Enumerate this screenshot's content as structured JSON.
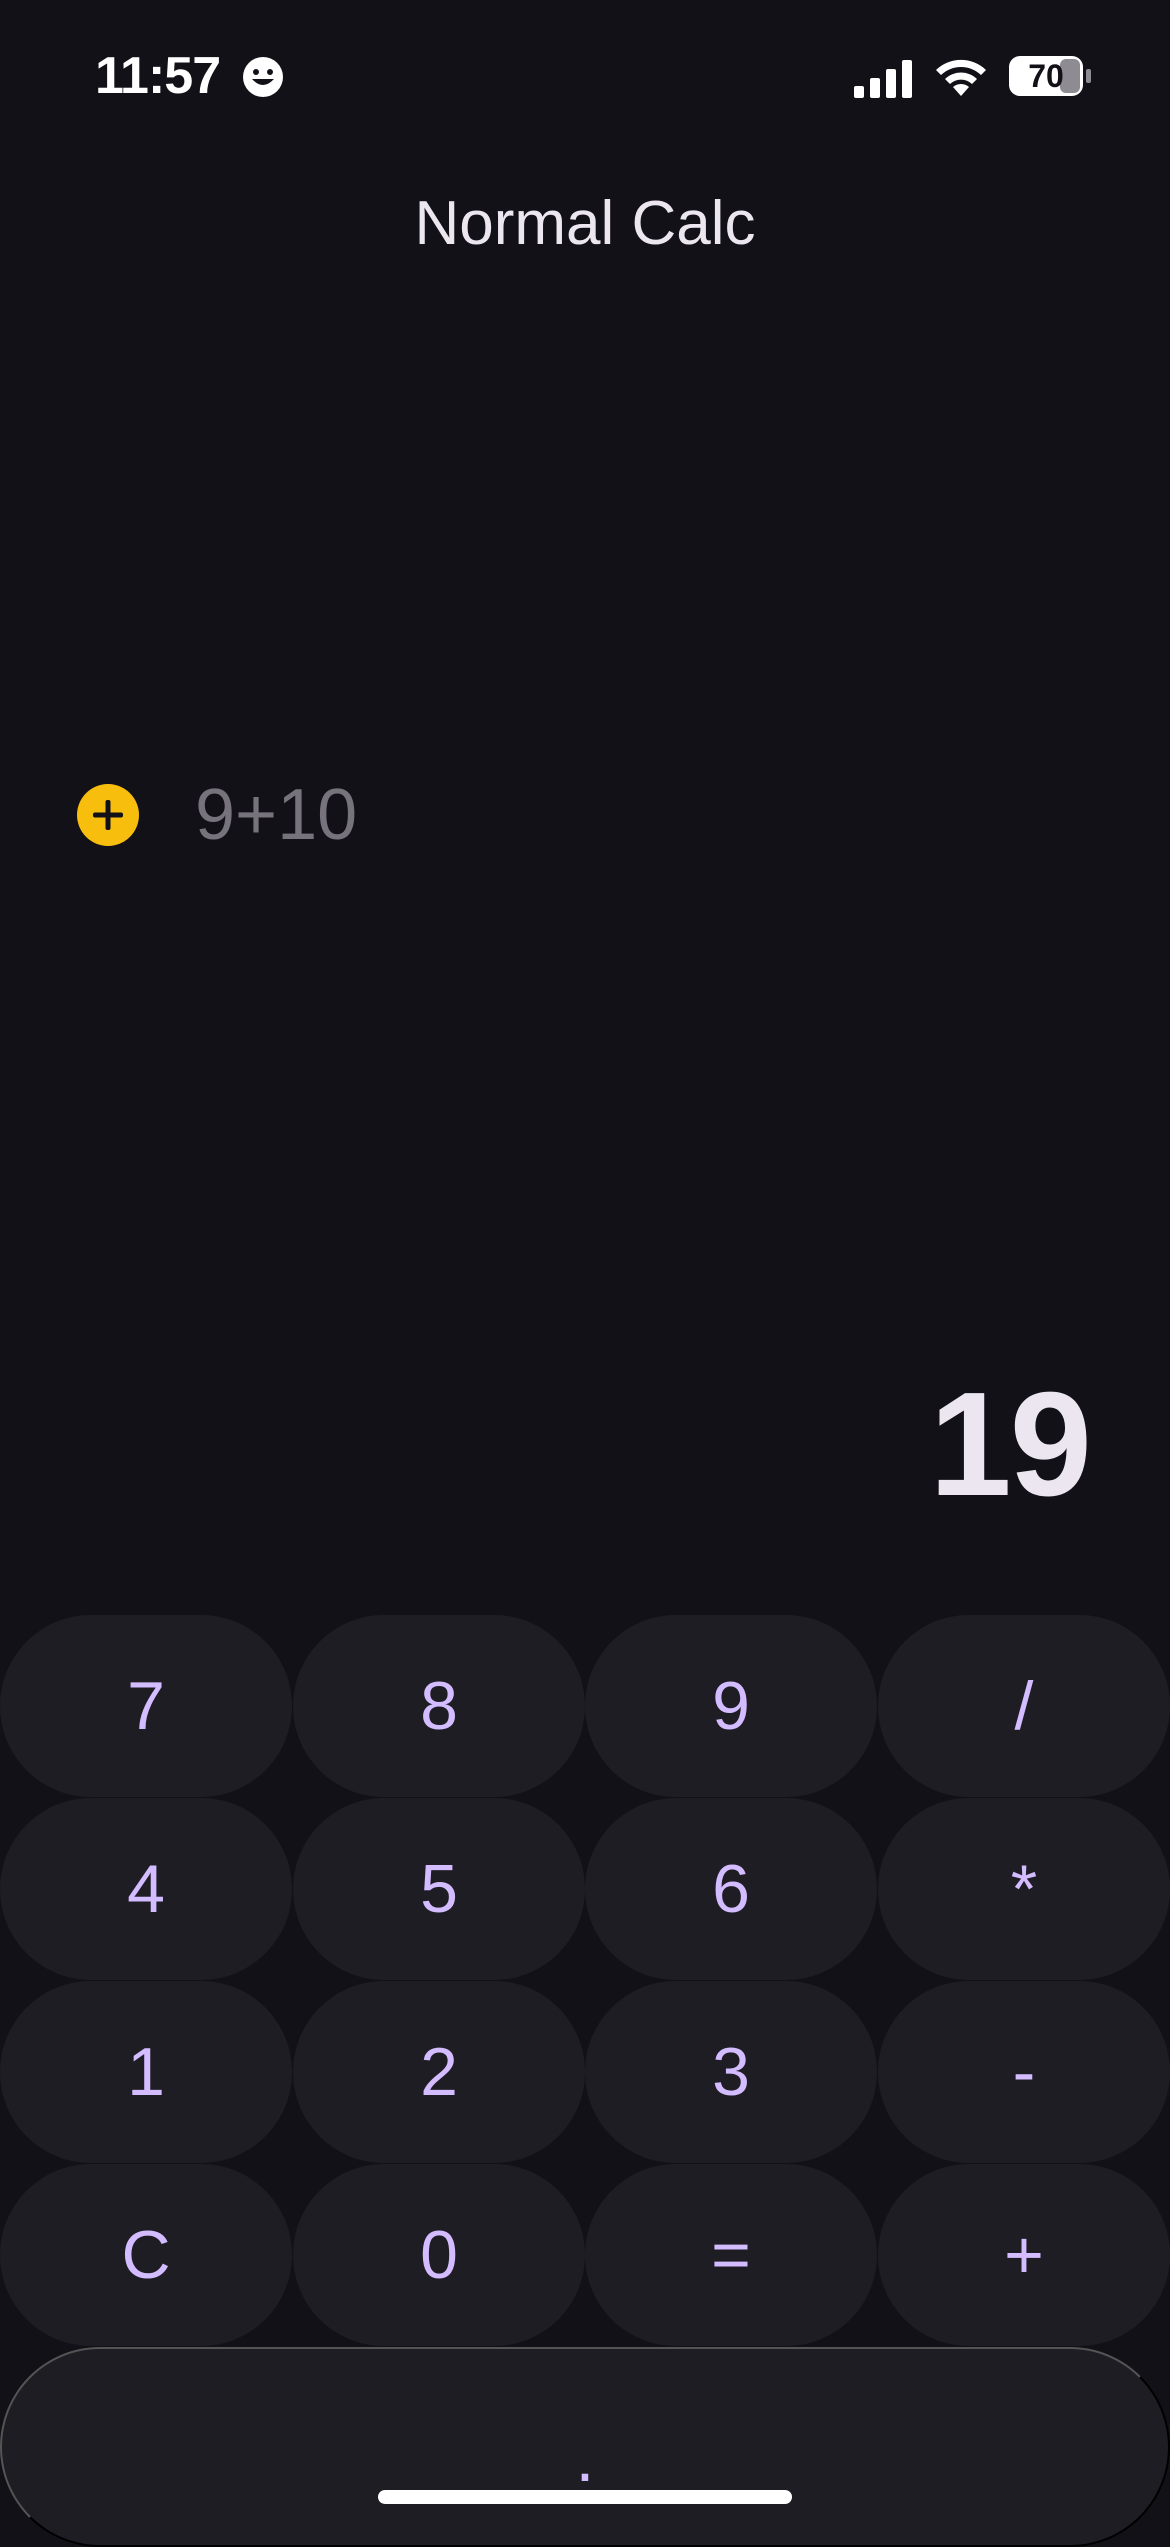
{
  "status_bar": {
    "time": "11:57",
    "battery": "70",
    "icons": [
      "smiley-icon",
      "signal-icon",
      "wifi-icon",
      "battery-icon"
    ]
  },
  "app": {
    "title": "Normal Calc"
  },
  "history": {
    "expression": "9+10",
    "icon": "add-circle-icon"
  },
  "display": {
    "result": "19"
  },
  "keypad": {
    "rows": [
      [
        "7",
        "8",
        "9",
        "/"
      ],
      [
        "4",
        "5",
        "6",
        "*"
      ],
      [
        "1",
        "2",
        "3",
        "-"
      ],
      [
        "C",
        "0",
        "=",
        "+"
      ]
    ],
    "decimal": "."
  },
  "colors": {
    "background": "#131118",
    "key_background": "#1F1D24",
    "key_text": "#D3BCFF",
    "accent_add": "#F7BE0E",
    "history_text": "#77737D",
    "result_text": "#ECE6F0"
  }
}
